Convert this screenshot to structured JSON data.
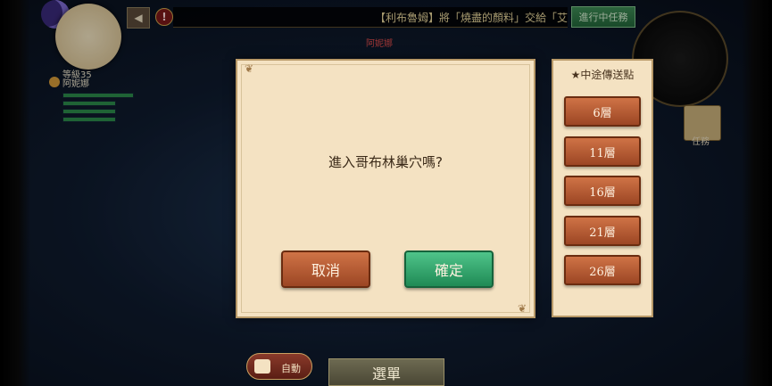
{
  "hud": {
    "level_label": "等級35",
    "player_name": "阿妮娜",
    "npc_name": "阿妮娜",
    "quest_text": "【利布魯姆】將「燒盡的顏料」交給「艾",
    "quest_button": "進行中任務",
    "task_label": "任務",
    "back_icon": "◀",
    "alert_icon": "!"
  },
  "dialog": {
    "message": "進入哥布林巢穴嗎?",
    "cancel_label": "取消",
    "confirm_label": "確定"
  },
  "teleport": {
    "title": "★中途傳送點",
    "floors": [
      "6層",
      "11層",
      "16層",
      "21層",
      "26層"
    ]
  },
  "bottom": {
    "auto_label": "自動",
    "menu_label": "選單"
  }
}
